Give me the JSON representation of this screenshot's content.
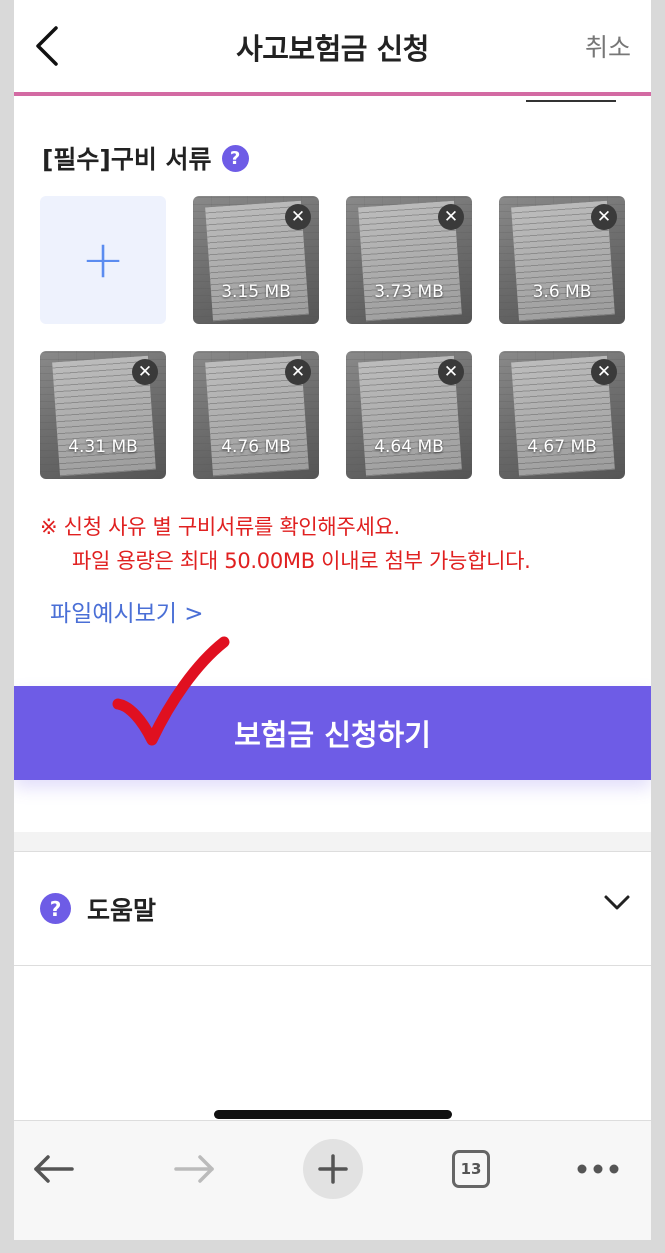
{
  "header": {
    "title": "사고보험금 신청",
    "cancel_label": "취소"
  },
  "documents": {
    "label": "[필수]구비 서류",
    "help_glyph": "?",
    "add_glyph": "+",
    "close_glyph": "✕",
    "files": [
      {
        "size": "3.15 MB"
      },
      {
        "size": "3.73 MB"
      },
      {
        "size": "3.6 MB"
      },
      {
        "size": "4.31 MB"
      },
      {
        "size": "4.76 MB"
      },
      {
        "size": "4.64 MB"
      },
      {
        "size": "4.67 MB"
      }
    ]
  },
  "notice": {
    "line1": "※ 신청 사유 별 구비서류를 확인해주세요.",
    "line2": "파일 용량은 최대 50.00MB 이내로 첨부 가능합니다."
  },
  "preview_link": "파일예시보기 >",
  "submit_label": "보험금 신청하기",
  "help": {
    "glyph": "?",
    "label": "도움말"
  },
  "bottom_bar": {
    "tab_count": "13"
  },
  "colors": {
    "accent": "#6e5ce6",
    "notice": "#e02020",
    "link": "#4a6fd6",
    "check": "#e01020"
  }
}
